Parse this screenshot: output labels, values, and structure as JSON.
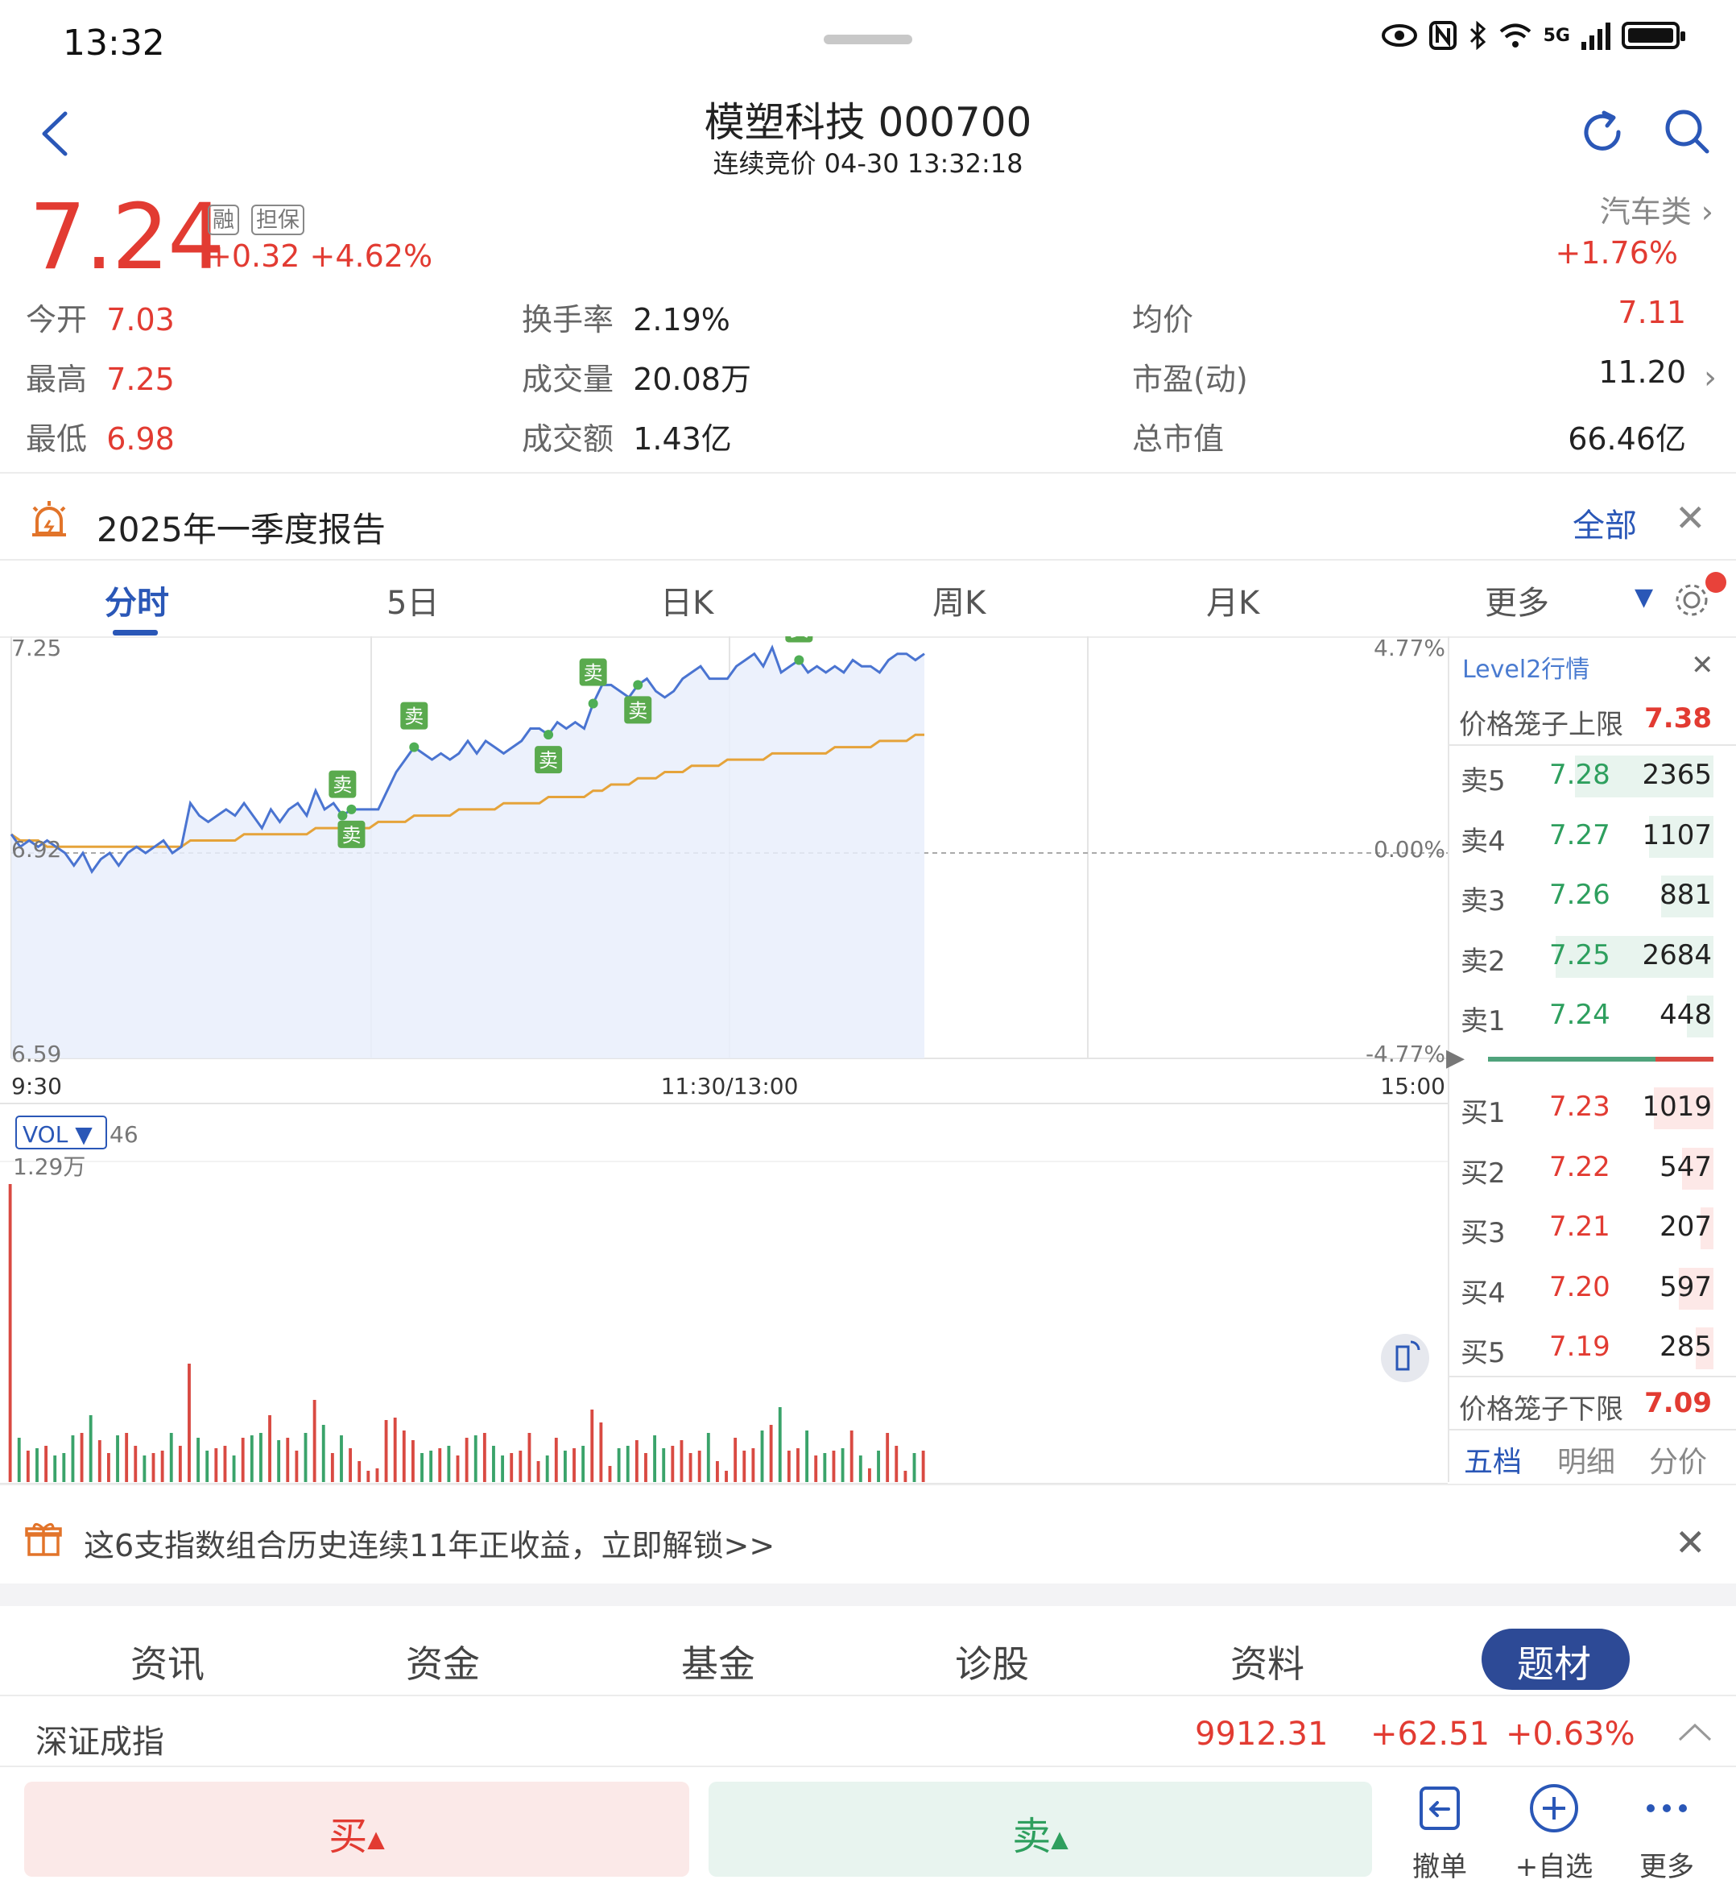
{
  "status_bar": {
    "time": "13:32",
    "network": "5G"
  },
  "header": {
    "title": "模塑科技 000700",
    "subtitle": "连续竞价 04-30 13:32:18"
  },
  "quote": {
    "price": "7.24",
    "tags": [
      "融",
      "担保"
    ],
    "change": "+0.32 +4.62%",
    "sector_name": "汽车类",
    "sector_change": "+1.76%"
  },
  "stats": {
    "open_label": "今开",
    "open": "7.03",
    "high_label": "最高",
    "high": "7.25",
    "low_label": "最低",
    "low": "6.98",
    "turnover_label": "换手率",
    "turnover": "2.19%",
    "volume_label": "成交量",
    "volume": "20.08万",
    "amount_label": "成交额",
    "amount": "1.43亿",
    "avg_label": "均价",
    "avg": "7.11",
    "pe_label": "市盈(动)",
    "pe": "11.20",
    "mcap_label": "总市值",
    "mcap": "66.46亿"
  },
  "report": {
    "text": "2025年一季度报告",
    "all_label": "全部"
  },
  "tabs": [
    "分时",
    "5日",
    "日K",
    "周K",
    "月K",
    "更多"
  ],
  "chart_labels": {
    "price_top": "7.25",
    "price_mid": "6.92",
    "price_bottom": "6.59",
    "pct_top": "4.77%",
    "pct_mid": "0.00%",
    "pct_bottom": "-4.77%",
    "time_start": "9:30",
    "time_mid": "11:30/13:00",
    "time_end": "15:00",
    "vol_selector": "VOL ▼",
    "vol_num": "46",
    "vol_max": "1.29万",
    "sell_marker": "卖"
  },
  "chart_data": {
    "type": "line",
    "ylim": [
      6.59,
      7.25
    ],
    "prev_close": 6.92,
    "x_label_ticks": [
      "9:30",
      "11:30/13:00",
      "15:00"
    ],
    "series": [
      {
        "name": "price",
        "values": [
          6.95,
          6.93,
          6.94,
          6.93,
          6.94,
          6.93,
          6.92,
          6.9,
          6.92,
          6.89,
          6.91,
          6.92,
          6.9,
          6.92,
          6.93,
          6.92,
          6.93,
          6.94,
          6.92,
          6.93,
          7.0,
          6.98,
          6.97,
          6.98,
          6.99,
          6.98,
          7.0,
          6.98,
          6.96,
          6.99,
          6.97,
          6.99,
          7.0,
          6.98,
          7.02,
          6.99,
          7.0,
          6.98,
          6.99,
          6.99,
          6.99,
          6.99,
          7.02,
          7.05,
          7.07,
          7.09,
          7.08,
          7.07,
          7.08,
          7.07,
          7.08,
          7.1,
          7.08,
          7.1,
          7.09,
          7.08,
          7.09,
          7.1,
          7.12,
          7.12,
          7.11,
          7.13,
          7.12,
          7.13,
          7.12,
          7.16,
          7.19,
          7.19,
          7.18,
          7.17,
          7.19,
          7.2,
          7.18,
          7.17,
          7.18,
          7.2,
          7.21,
          7.22,
          7.2,
          7.2,
          7.2,
          7.22,
          7.23,
          7.24,
          7.22,
          7.25,
          7.21,
          7.22,
          7.23,
          7.21,
          7.22,
          7.21,
          7.22,
          7.21,
          7.23,
          7.22,
          7.22,
          7.21,
          7.23,
          7.24,
          7.24,
          7.23,
          7.24
        ]
      },
      {
        "name": "avg",
        "values": [
          6.95,
          6.94,
          6.94,
          6.94,
          6.93,
          6.93,
          6.93,
          6.93,
          6.93,
          6.93,
          6.93,
          6.93,
          6.93,
          6.93,
          6.93,
          6.93,
          6.93,
          6.93,
          6.93,
          6.93,
          6.94,
          6.94,
          6.94,
          6.94,
          6.94,
          6.94,
          6.95,
          6.95,
          6.95,
          6.95,
          6.95,
          6.95,
          6.95,
          6.95,
          6.96,
          6.96,
          6.96,
          6.96,
          6.96,
          6.96,
          6.96,
          6.97,
          6.97,
          6.97,
          6.97,
          6.98,
          6.98,
          6.98,
          6.98,
          6.98,
          6.99,
          6.99,
          6.99,
          6.99,
          6.99,
          7.0,
          7.0,
          7.0,
          7.0,
          7.0,
          7.01,
          7.01,
          7.01,
          7.01,
          7.01,
          7.02,
          7.02,
          7.03,
          7.03,
          7.03,
          7.04,
          7.04,
          7.04,
          7.05,
          7.05,
          7.05,
          7.06,
          7.06,
          7.06,
          7.06,
          7.07,
          7.07,
          7.07,
          7.07,
          7.07,
          7.08,
          7.08,
          7.08,
          7.08,
          7.08,
          7.08,
          7.08,
          7.09,
          7.09,
          7.09,
          7.09,
          7.09,
          7.1,
          7.1,
          7.1,
          7.1,
          7.11,
          7.11
        ]
      }
    ],
    "sell_marker_index": [
      37,
      38,
      45,
      60,
      65,
      70,
      88
    ]
  },
  "level2": {
    "title": "Level2行情",
    "upper_limit_label": "价格笼子上限",
    "upper_limit": "7.38",
    "lower_limit_label": "价格笼子下限",
    "lower_limit": "7.09",
    "asks": [
      {
        "label": "卖5",
        "price": "7.28",
        "vol": "2365",
        "ratio": 0.88
      },
      {
        "label": "卖4",
        "price": "7.27",
        "vol": "1107",
        "ratio": 0.41
      },
      {
        "label": "卖3",
        "price": "7.26",
        "vol": "881",
        "ratio": 0.33
      },
      {
        "label": "卖2",
        "price": "7.25",
        "vol": "2684",
        "ratio": 1.0
      },
      {
        "label": "卖1",
        "price": "7.24",
        "vol": "448",
        "ratio": 0.17
      }
    ],
    "bids": [
      {
        "label": "买1",
        "price": "7.23",
        "vol": "1019",
        "ratio": 0.38
      },
      {
        "label": "买2",
        "price": "7.22",
        "vol": "547",
        "ratio": 0.2
      },
      {
        "label": "买3",
        "price": "7.21",
        "vol": "207",
        "ratio": 0.08
      },
      {
        "label": "买4",
        "price": "7.20",
        "vol": "597",
        "ratio": 0.22
      },
      {
        "label": "买5",
        "price": "7.19",
        "vol": "285",
        "ratio": 0.11
      }
    ],
    "tabs": [
      "五档",
      "明细",
      "分价"
    ]
  },
  "promo": {
    "text": "这6支指数组合历史连续11年正收益，立即解锁>>"
  },
  "bottom_tabs": [
    "资讯",
    "资金",
    "基金",
    "诊股",
    "资料",
    "题材"
  ],
  "index_bar": {
    "name": "深证成指",
    "value": "9912.31",
    "change": "+62.51",
    "pct": "+0.63%"
  },
  "actions": {
    "buy": "买",
    "sell": "卖",
    "cancel": "撤单",
    "watchlist": "+自选",
    "more": "更多"
  },
  "colors": {
    "up": "#e23b32",
    "down": "#2e9f5e",
    "accent": "#2a57b7",
    "price_line": "#4a74d1",
    "avg_line": "#e5a33a"
  }
}
